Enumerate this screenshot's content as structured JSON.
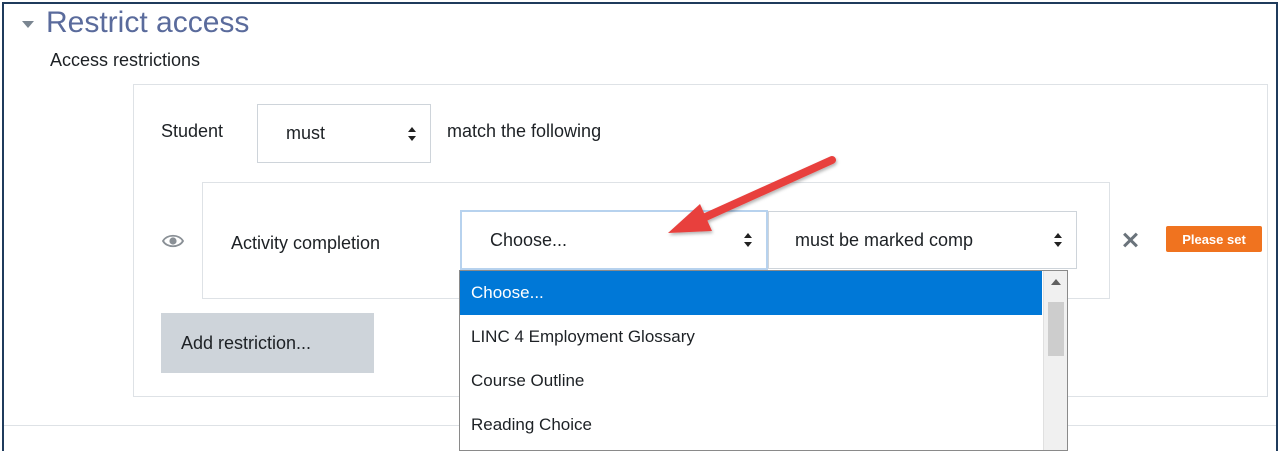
{
  "section": {
    "title": "Restrict access",
    "subtitle": "Access restrictions"
  },
  "rule": {
    "subject": "Student",
    "must_value": "must",
    "match_text": "match the following"
  },
  "condition": {
    "type_label": "Activity completion",
    "activity_value": "Choose...",
    "completion_value": "must be marked comp",
    "badge": "Please set"
  },
  "buttons": {
    "add_restriction": "Add restriction..."
  },
  "dropdown": {
    "options": [
      "Choose...",
      "LINC 4 Employment Glossary",
      "Course Outline",
      "Reading Choice"
    ],
    "selected_index": 0
  },
  "colors": {
    "accent": "#0078d7",
    "badge": "#f0731f",
    "title": "#5a6b9c",
    "annotation_arrow": "#e8413e"
  },
  "icons": [
    "chevron-down-icon",
    "eye-icon",
    "close-icon",
    "annotation-arrow-icon"
  ]
}
